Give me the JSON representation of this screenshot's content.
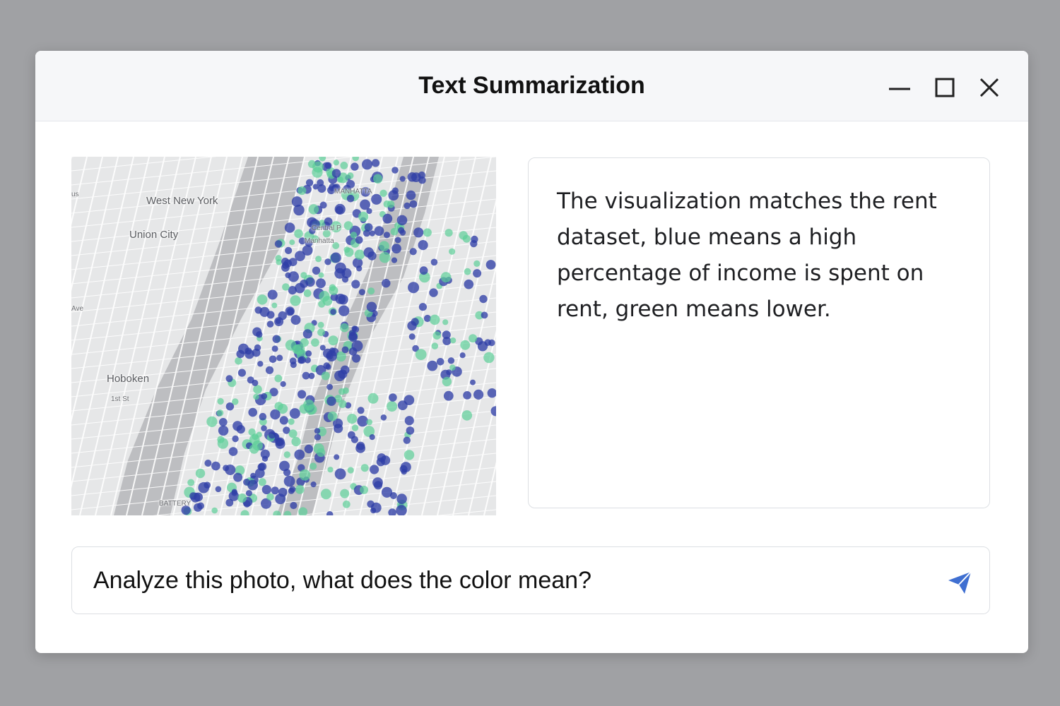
{
  "window": {
    "title": "Text Summarization",
    "controls": {
      "minimize_icon": "minimize-icon",
      "maximize_icon": "maximize-icon",
      "close_icon": "close-icon"
    }
  },
  "map": {
    "labels": {
      "west_new_york": "West New York",
      "union_city": "Union City",
      "hoboken": "Hoboken",
      "first_st": "1st St",
      "central_park": "Central P",
      "manhattan": "Manhatta",
      "manhattan_top": "MANHATTA",
      "battery": "BATTERY",
      "us": "us",
      "ave": "Ave"
    },
    "colors": {
      "high": "#2f3fa6",
      "low": "#5ccf98",
      "water": "#b9babd",
      "land": "#e8e9ea",
      "roads": "#ffffff"
    }
  },
  "response": {
    "text": "The visualization matches the rent dataset, blue means a high percentage of income is spent on rent, green means lower."
  },
  "prompt": {
    "value": "Analyze this photo, what does the color mean?",
    "send_icon": "send-icon",
    "accent": "#3f6fd1"
  }
}
